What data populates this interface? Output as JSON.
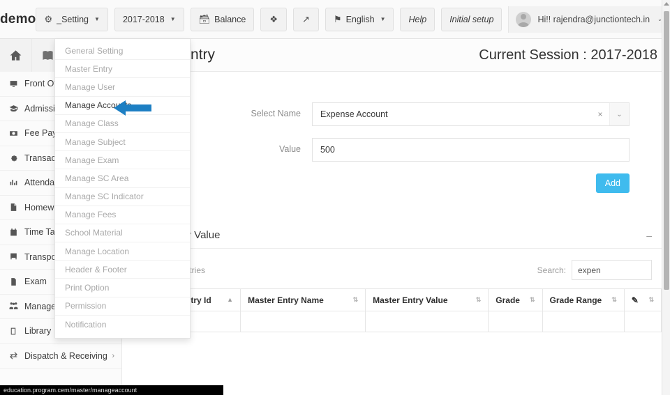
{
  "topbar": {
    "brand": "demo",
    "buttons": [
      {
        "label": "_Setting",
        "icon": "gear-icon",
        "caret": true
      },
      {
        "label": "2017-2018",
        "icon": "",
        "caret": true
      },
      {
        "label": "Balance",
        "icon": "database-icon",
        "caret": false
      },
      {
        "label": "",
        "icon": "fullscreen-icon",
        "caret": false
      },
      {
        "label": "",
        "icon": "expand-arrow-icon",
        "caret": false
      },
      {
        "label": "English",
        "icon": "flag-icon",
        "caret": true
      },
      {
        "label": "Help",
        "icon": "",
        "caret": false
      },
      {
        "label": "Initial setup",
        "icon": "",
        "caret": false
      }
    ],
    "user": {
      "label": "Hi!! rajendra@junctiontech.in",
      "caret": "⌄"
    }
  },
  "sidebar": {
    "top_buttons": [
      {
        "name": "home-icon"
      },
      {
        "name": "translate-book-icon"
      }
    ],
    "items": [
      {
        "label": "Front Office",
        "icon": "monitor-icon",
        "arrow": ""
      },
      {
        "label": "Admission",
        "icon": "graduation-cap-icon",
        "arrow": ""
      },
      {
        "label": "Fee Payment",
        "icon": "money-icon",
        "arrow": ""
      },
      {
        "label": "Transaction",
        "icon": "gear-icon",
        "arrow": ""
      },
      {
        "label": "Attendance",
        "icon": "bar-chart-icon",
        "arrow": ""
      },
      {
        "label": "Homework",
        "icon": "document-icon",
        "arrow": ""
      },
      {
        "label": "Time Table",
        "icon": "calendar-icon",
        "arrow": ""
      },
      {
        "label": "Transport",
        "icon": "bus-icon",
        "arrow": ""
      },
      {
        "label": "Exam",
        "icon": "file-icon",
        "arrow": ""
      },
      {
        "label": "Manage Staff",
        "icon": "people-icon",
        "arrow": ""
      },
      {
        "label": "Library",
        "icon": "book-icon",
        "arrow": "›"
      },
      {
        "label": "Dispatch & Receiving",
        "icon": "transfer-icon",
        "arrow": "›"
      }
    ]
  },
  "setting_menu": {
    "items": [
      {
        "label": "General Setting",
        "active": false
      },
      {
        "label": "Master Entry",
        "active": false
      },
      {
        "label": "Manage User",
        "active": false
      },
      {
        "label": "Manage Accounts",
        "active": true
      },
      {
        "label": "Manage Class",
        "active": false
      },
      {
        "label": "Manage Subject",
        "active": false
      },
      {
        "label": "Manage Exam",
        "active": false
      },
      {
        "label": "Manage SC Area",
        "active": false
      },
      {
        "label": "Manage SC Indicator",
        "active": false
      },
      {
        "label": "Manage Fees",
        "active": false
      },
      {
        "label": "School Material",
        "active": false
      },
      {
        "label": "Manage Location",
        "active": false
      },
      {
        "label": "Header & Footer",
        "active": false
      },
      {
        "label": "Print Option",
        "active": false
      },
      {
        "label": "Permission",
        "active": false
      },
      {
        "label": "Notification",
        "active": false
      }
    ],
    "pointer_color": "#1d7fc3"
  },
  "page": {
    "title": "Master Entry",
    "session": "Current Session : 2017-2018"
  },
  "form": {
    "select_name_label": "Select Name",
    "select_name_value": "Expense Account",
    "clear_glyph": "×",
    "caret_glyph": "⌄",
    "value_label": "Value",
    "value_value": "500",
    "add_label": "Add",
    "add_color": "#3fbbee"
  },
  "table_panel": {
    "title": "Master Entry Value",
    "minimize_glyph": "–",
    "entries_label": "entries",
    "length_value": "",
    "search_label": "Search:",
    "search_value": "expen",
    "columns": [
      {
        "label": "Master Entry Id",
        "sort": "asc"
      },
      {
        "label": "Master Entry Name",
        "sort": "both"
      },
      {
        "label": "Master Entry Value",
        "sort": "both"
      },
      {
        "label": "Grade",
        "sort": "both"
      },
      {
        "label": "Grade Range",
        "sort": "both"
      },
      {
        "label": "",
        "sort": "both",
        "icon": "edit-icon"
      }
    ],
    "rows": []
  },
  "statusbar": {
    "text": "education.program.cem/master/manageaccount"
  }
}
